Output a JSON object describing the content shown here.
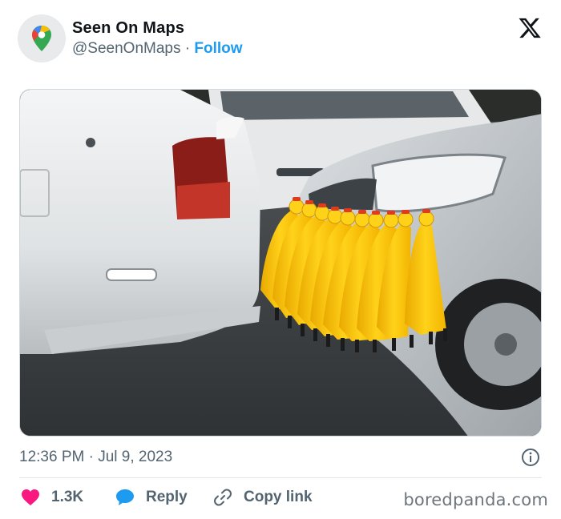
{
  "tweet": {
    "author_name": "Seen On Maps",
    "handle": "@SeenOnMaps",
    "separator": "·",
    "follow_label": "Follow",
    "timestamp": "12:36 PM · Jul 9, 2023",
    "likes": "1.3K",
    "reply_label": "Reply",
    "copy_link_label": "Copy link"
  },
  "icons": {
    "avatar": "google-maps-pin-icon",
    "brand": "x-logo-icon",
    "info": "info-icon",
    "like": "heart-icon",
    "reply": "speech-bubble-icon",
    "copy": "link-icon"
  },
  "watermark": "boredpanda.com",
  "colors": {
    "follow": "#1d9bf0",
    "heart": "#f91880",
    "reply": "#1d9bf0",
    "secondary_text": "#536471"
  }
}
